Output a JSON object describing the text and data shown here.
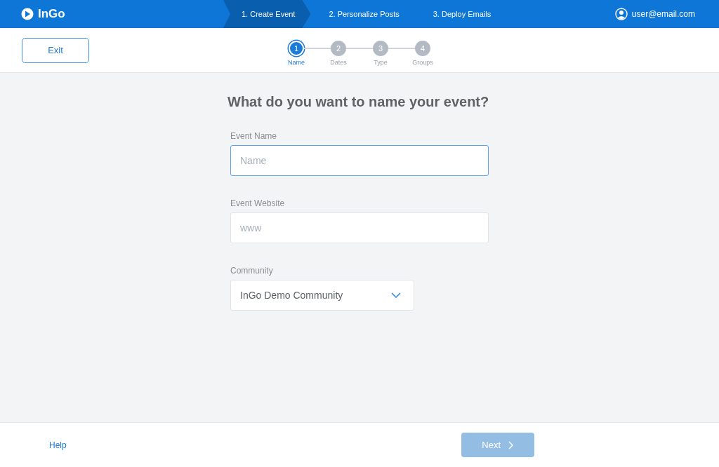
{
  "app": {
    "name": "InGo"
  },
  "stages": [
    {
      "label": "1. Create Event",
      "selected": true
    },
    {
      "label": "2. Personalize Posts",
      "selected": false
    },
    {
      "label": "3. Deploy Emails",
      "selected": false
    }
  ],
  "user": {
    "email": "user@email.com"
  },
  "exit_button": "Exit",
  "steps": [
    {
      "number": "1",
      "label": "Name",
      "selected": true
    },
    {
      "number": "2",
      "label": "Dates",
      "selected": false
    },
    {
      "number": "3",
      "label": "Type",
      "selected": false
    },
    {
      "number": "4",
      "label": "Groups",
      "selected": false
    }
  ],
  "heading": "What do you want to name your event?",
  "fields": [
    {
      "kind": "text",
      "label": "Event Name",
      "placeholder": "Name",
      "focused": true
    },
    {
      "kind": "text",
      "label": "Event Website",
      "placeholder": "www",
      "focused": false
    },
    {
      "kind": "select",
      "label": "Community",
      "value": "InGo Demo Community",
      "focused": false
    }
  ],
  "footer": {
    "help": "Help",
    "next": {
      "label": "Next",
      "disabled": true
    }
  }
}
